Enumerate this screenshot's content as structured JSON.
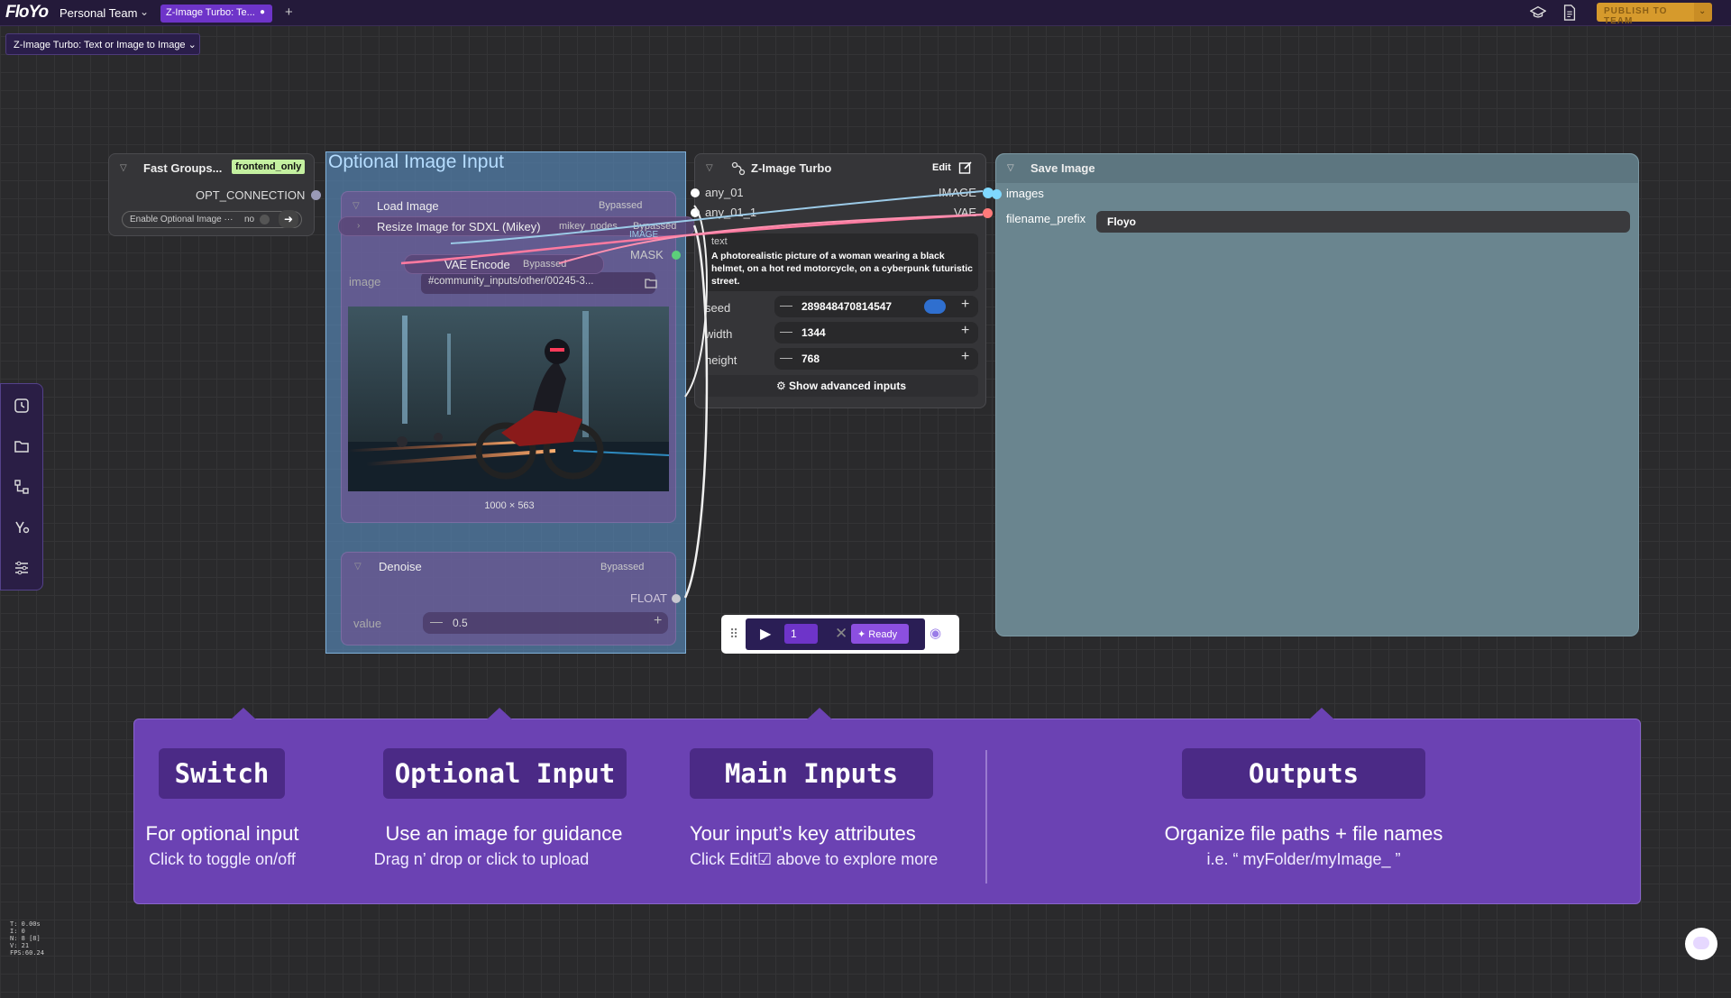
{
  "topbar": {
    "logo": "FloYo",
    "team": "Personal Team",
    "tab_label": "Z-Image Turbo: Te...",
    "publish": "PUBLISH TO TEAM",
    "workflow_selector": "Z-Image Turbo: Text or Image to Image"
  },
  "fast_groups": {
    "title": "Fast Groups...",
    "badge": "frontend_only",
    "output": "OPT_CONNECTION",
    "toggle_label": "Enable Optional Image ···",
    "toggle_value": "no"
  },
  "group": {
    "title": "Optional Image Input",
    "load_image": {
      "title": "Load Image",
      "status": "Bypassed",
      "input_label": "image",
      "file": "#community_inputs/other/00245-3...",
      "dimensions": "1000 × 563",
      "mask_label": "MASK"
    },
    "resize": {
      "title": "Resize Image for SDXL (Mikey)",
      "pack": "mikey_nodes",
      "status": "Bypassed",
      "output": "IMAGE"
    },
    "vae_encode": {
      "title": "VAE Encode",
      "status": "Bypassed"
    },
    "denoise": {
      "title": "Denoise",
      "status": "Bypassed",
      "output": "FLOAT",
      "value_label": "value",
      "value": "0.5"
    }
  },
  "z_image": {
    "title": "Z-Image Turbo",
    "edit": "Edit",
    "inputs": [
      "any_01",
      "any_01_1"
    ],
    "outputs": [
      "IMAGE",
      "VAE"
    ],
    "text_label": "text",
    "prompt": "A photorealistic picture of a woman wearing a black helmet, on a hot red motorcycle, on a cyberpunk futuristic street.",
    "seed_label": "seed",
    "seed": "289848470814547",
    "width_label": "width",
    "width": "1344",
    "height_label": "height",
    "height": "768",
    "advanced": "Show advanced inputs"
  },
  "save_image": {
    "title": "Save Image",
    "input": "images",
    "prefix_label": "filename_prefix",
    "prefix_value": "Floyo"
  },
  "run": {
    "count": "1",
    "status": "Ready"
  },
  "panel": {
    "items": [
      {
        "heading": "Switch",
        "line1": "For optional input",
        "line2": "Click to toggle on/off"
      },
      {
        "heading": "Optional Input",
        "line1": "Use an image for guidance",
        "line2": "Drag n’ drop or click to upload"
      },
      {
        "heading": "Main Inputs",
        "line1": "Your input’s key attributes",
        "line2_a": "Click Edit",
        "line2_b": " above to explore more"
      },
      {
        "heading": "Outputs",
        "line1": "Organize file paths + file names",
        "line2": "i.e. “ myFolder/myImage_ ”"
      }
    ]
  },
  "stats": [
    "T: 0.00s",
    "I: 0",
    "N: 8 [8]",
    "V: 21",
    "FPS:60.24"
  ],
  "colors": {
    "accent": "#6e34c9",
    "panel": "#6b42b3",
    "publish": "#d69a2c",
    "group": "#5582af",
    "save": "#6a858f"
  }
}
